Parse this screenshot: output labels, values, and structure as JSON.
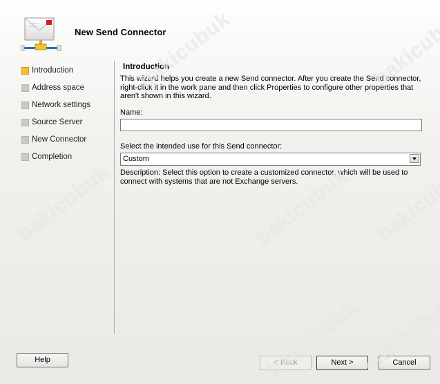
{
  "header": {
    "title": "New Send Connector"
  },
  "steps": [
    {
      "label": "Introduction",
      "active": true
    },
    {
      "label": "Address space",
      "active": false
    },
    {
      "label": "Network settings",
      "active": false
    },
    {
      "label": "Source Server",
      "active": false
    },
    {
      "label": "New Connector",
      "active": false
    },
    {
      "label": "Completion",
      "active": false
    }
  ],
  "content": {
    "section_title": "Introduction",
    "intro_text": "This wizard helps you create a new Send connector. After you create the Send connector, right-click it in the work pane and then click Properties to configure other properties that aren't shown in this wizard.",
    "name_label": "Name:",
    "name_value": "",
    "use_label": "Select the intended use for this Send connector:",
    "use_value": "Custom",
    "description": "Description: Select this option to create a customized connector, which will be used to connect with systems that are not Exchange servers."
  },
  "buttons": {
    "help": "Help",
    "back": "< Back",
    "next": "Next >",
    "cancel": "Cancel"
  },
  "watermark": "bakicubuk",
  "colors": {
    "active_step": "#f2c42a",
    "inactive_step": "#c9c9c6",
    "accent_red": "#d41c24"
  }
}
